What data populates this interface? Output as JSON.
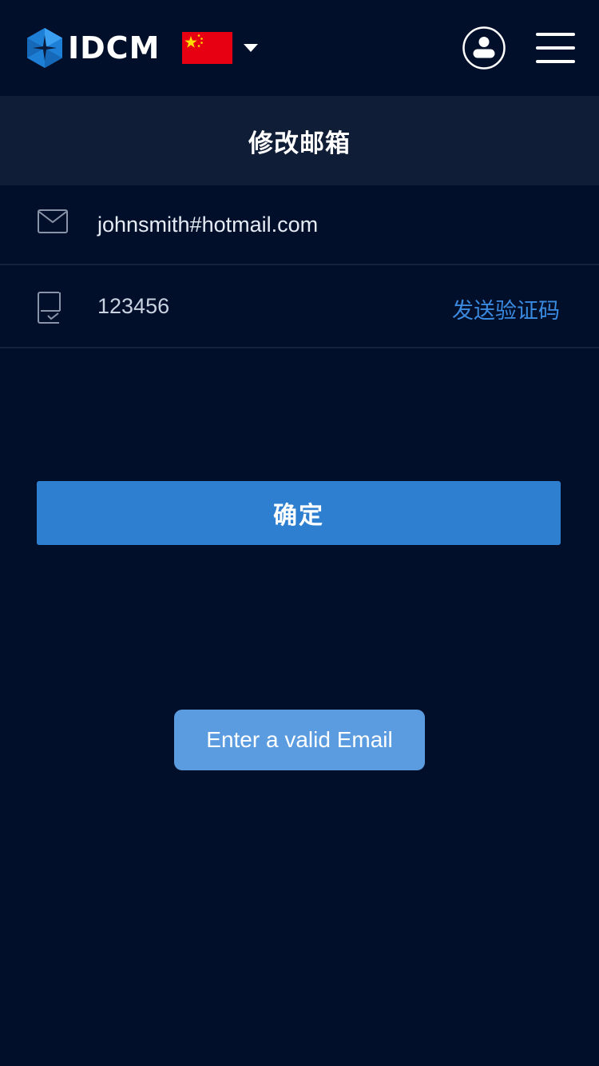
{
  "header": {
    "logo_text": "IDCM",
    "language_flag": "china-flag",
    "icons": {
      "logo": "hexagon-logo-icon",
      "caret": "caret-down-icon",
      "user": "user-circle-icon",
      "menu": "hamburger-menu-icon"
    }
  },
  "page": {
    "title": "修改邮箱"
  },
  "form": {
    "email": {
      "icon": "envelope-icon",
      "value": "johnsmith#hotmail.com"
    },
    "code": {
      "icon": "verification-code-icon",
      "value": "123456",
      "send_label": "发送验证码"
    },
    "confirm_label": "确定"
  },
  "toast": {
    "message": "Enter a valid Email"
  },
  "colors": {
    "background": "#020f2a",
    "title_bar": "#101d36",
    "accent": "#2f7fd1",
    "link": "#3a8ae0",
    "toast": "#5b9be0"
  }
}
